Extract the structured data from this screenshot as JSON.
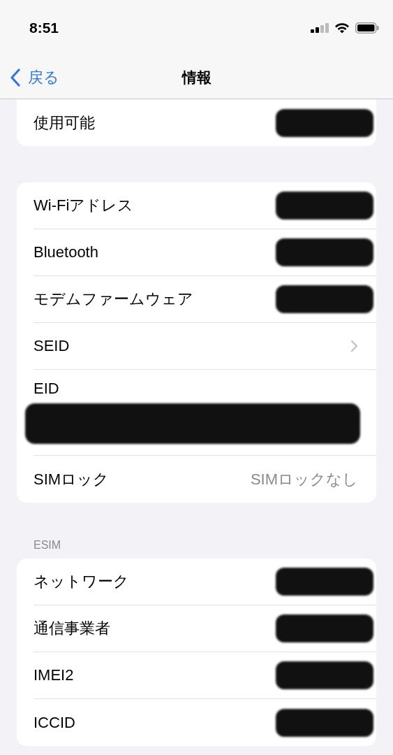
{
  "status_bar": {
    "time": "8:51"
  },
  "nav": {
    "back": "戻る",
    "title": "情報"
  },
  "sections": [
    {
      "rows": [
        {
          "label": "使用可能",
          "kind": "redacted"
        }
      ]
    },
    {
      "rows": [
        {
          "label": "Wi-Fiアドレス",
          "kind": "redacted"
        },
        {
          "label": "Bluetooth",
          "kind": "redacted"
        },
        {
          "label": "モデムファームウェア",
          "kind": "redacted"
        },
        {
          "label": "SEID",
          "kind": "chevron"
        },
        {
          "label": "EID",
          "kind": "redacted_block"
        },
        {
          "label": "SIMロック",
          "kind": "value",
          "value": "SIMロックなし"
        }
      ]
    },
    {
      "header": "ESIM",
      "rows": [
        {
          "label": "ネットワーク",
          "kind": "redacted"
        },
        {
          "label": "通信事業者",
          "kind": "redacted"
        },
        {
          "label": "IMEI2",
          "kind": "redacted"
        },
        {
          "label": "ICCID",
          "kind": "redacted"
        }
      ]
    }
  ]
}
